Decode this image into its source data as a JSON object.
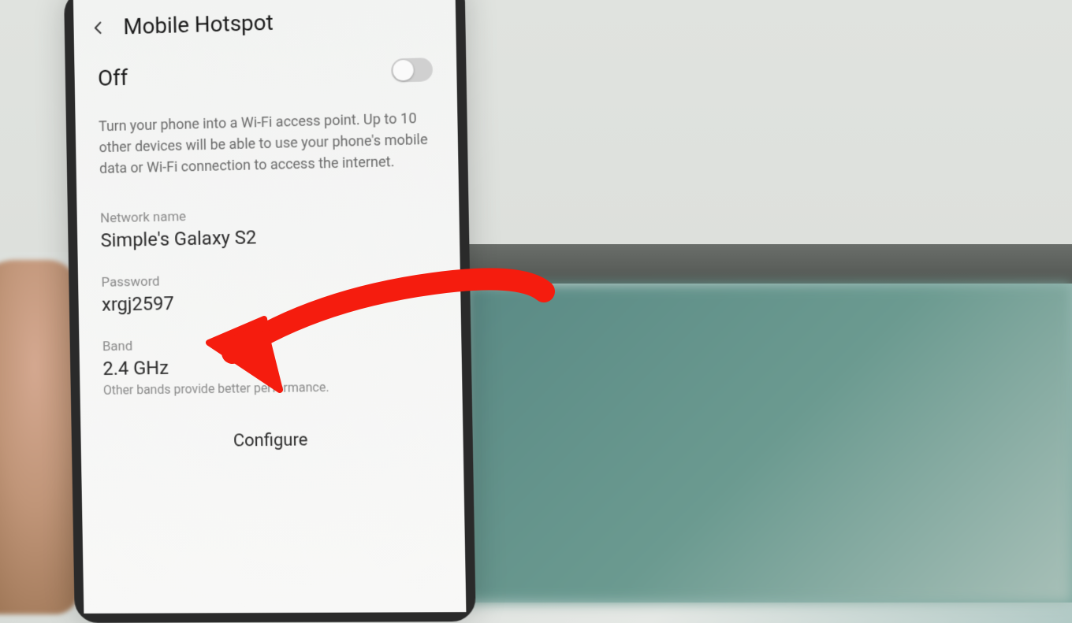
{
  "header": {
    "title": "Mobile Hotspot"
  },
  "toggle": {
    "label": "Off",
    "state": false
  },
  "description": "Turn your phone into a Wi-Fi access point. Up to 10 other devices will be able to use your phone's mobile data or Wi-Fi connection to access the internet.",
  "fields": {
    "network": {
      "label": "Network name",
      "value": "Simple's Galaxy S2"
    },
    "password": {
      "label": "Password",
      "value": "xrgj2597"
    },
    "band": {
      "label": "Band",
      "value": "2.4 GHz",
      "hint": "Other bands provide better performance."
    }
  },
  "configure_label": "Configure",
  "annotation": {
    "color": "#f51c0e"
  }
}
